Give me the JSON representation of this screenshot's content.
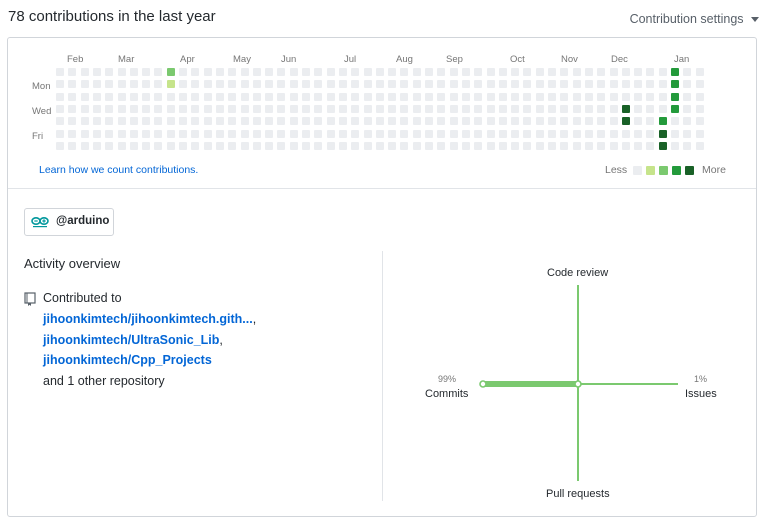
{
  "header": {
    "title": "78 contributions in the last year",
    "settings_label": "Contribution settings"
  },
  "calendar": {
    "months": [
      "Feb",
      "Mar",
      "Apr",
      "May",
      "Jun",
      "Jul",
      "Aug",
      "Sep",
      "Oct",
      "Nov",
      "Dec",
      "Jan"
    ],
    "days": [
      "Mon",
      "Wed",
      "Fri"
    ],
    "learn_link": "Learn how we count contributions.",
    "legend_less": "Less",
    "legend_more": "More",
    "colors": [
      "#ebedf0",
      "#c6e48b",
      "#7bc96f",
      "#239a3b",
      "#196127"
    ],
    "week_count": 53,
    "active_cells": [
      {
        "week": 9,
        "day": 0,
        "level": 2
      },
      {
        "week": 9,
        "day": 1,
        "level": 1
      },
      {
        "week": 46,
        "day": 3,
        "level": 4
      },
      {
        "week": 46,
        "day": 4,
        "level": 4
      },
      {
        "week": 49,
        "day": 4,
        "level": 3
      },
      {
        "week": 49,
        "day": 5,
        "level": 4
      },
      {
        "week": 49,
        "day": 6,
        "level": 4
      },
      {
        "week": 50,
        "day": 0,
        "level": 3
      },
      {
        "week": 50,
        "day": 1,
        "level": 3
      },
      {
        "week": 50,
        "day": 2,
        "level": 3
      },
      {
        "week": 50,
        "day": 3,
        "level": 3
      }
    ]
  },
  "org": {
    "name": "@arduino",
    "logo_text": "ARDUINO"
  },
  "activity": {
    "title": "Activity overview",
    "contributed_label": "Contributed to",
    "repos": [
      "jihoonkimtech/jihoonkimtech.gith...",
      "jihoonkimtech/UltraSonic_Lib",
      "jihoonkimtech/Cpp_Projects"
    ],
    "other": "and 1 other repository"
  },
  "overview": {
    "code_review": "Code review",
    "issues": "Issues",
    "issues_pct": "1%",
    "pull_requests": "Pull requests",
    "commits": "Commits",
    "commits_pct": "99%",
    "line_color": "#7bc96f"
  }
}
